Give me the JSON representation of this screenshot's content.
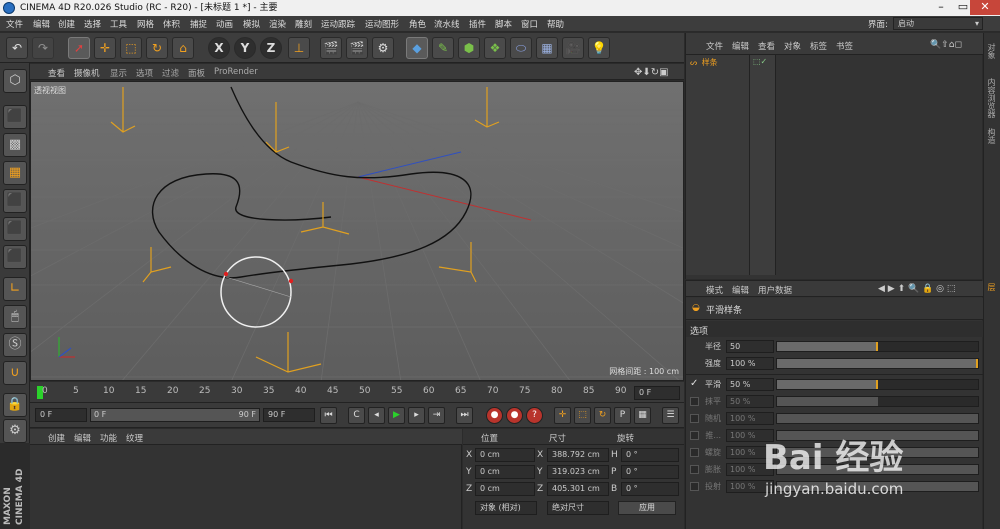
{
  "window": {
    "title": "CINEMA 4D R20.026 Studio (RC - R20) - [未标题 1 *] - 主要"
  },
  "menubar": {
    "items": [
      "文件",
      "编辑",
      "创建",
      "选择",
      "工具",
      "网格",
      "体积",
      "捕捉",
      "动画",
      "模拟",
      "渲染",
      "雕刻",
      "运动跟踪",
      "运动图形",
      "角色",
      "流水线",
      "插件",
      "脚本",
      "窗口",
      "帮助"
    ],
    "layout_label": "界面:",
    "layout_value": "启动"
  },
  "viewport": {
    "menu": [
      "查看",
      "摄像机",
      "显示",
      "选项",
      "过滤",
      "面板",
      "ProRender"
    ],
    "label": "透视视图",
    "grid_spacing": "网格间距 : 100 cm"
  },
  "timeline": {
    "ticks": [
      "0",
      "5",
      "10",
      "15",
      "20",
      "25",
      "30",
      "35",
      "40",
      "45",
      "50",
      "55",
      "60",
      "65",
      "70",
      "75",
      "80",
      "85",
      "90"
    ],
    "current_frame": "0 F"
  },
  "playbar": {
    "start": "0 F",
    "range_start": "0 F",
    "range_end": "90 F",
    "end": "90 F"
  },
  "materials": {
    "tabs": [
      "创建",
      "编辑",
      "功能",
      "纹理"
    ]
  },
  "coordinates": {
    "headers": [
      "位置",
      "尺寸",
      "旋转"
    ],
    "rows": [
      {
        "axis": "X",
        "pos": "0 cm",
        "size_axis": "X",
        "size": "388.792 cm",
        "rot_axis": "H",
        "rot": "0 °"
      },
      {
        "axis": "Y",
        "pos": "0 cm",
        "size_axis": "Y",
        "size": "319.023 cm",
        "rot_axis": "P",
        "rot": "0 °"
      },
      {
        "axis": "Z",
        "pos": "0 cm",
        "size_axis": "Z",
        "size": "405.301 cm",
        "rot_axis": "B",
        "rot": "0 °"
      }
    ],
    "mode": "对象 (相对)",
    "size_mode": "绝对尺寸",
    "apply": "应用"
  },
  "object_manager": {
    "menu": [
      "文件",
      "编辑",
      "查看",
      "对象",
      "标签",
      "书签"
    ],
    "objects": [
      {
        "name": "样条"
      }
    ]
  },
  "attribute_manager": {
    "menu": [
      "模式",
      "编辑",
      "用户数据"
    ],
    "object_name": "平滑样条",
    "section": "选项",
    "radius": {
      "label": "半径",
      "value": "50",
      "fill": 0.5
    },
    "strength": {
      "label": "强度",
      "value": "100 %",
      "fill": 1.0
    },
    "params": [
      {
        "label": "平滑",
        "value": "50 %",
        "fill": 0.5,
        "enabled": true
      },
      {
        "label": "抹平",
        "value": "50 %",
        "fill": 0.5,
        "enabled": false
      },
      {
        "label": "随机",
        "value": "100 %",
        "fill": 1.0,
        "enabled": false
      },
      {
        "label": "推...",
        "value": "100 %",
        "fill": 1.0,
        "enabled": false
      },
      {
        "label": "螺旋",
        "value": "100 %",
        "fill": 1.0,
        "enabled": false
      },
      {
        "label": "膨胀",
        "value": "100 %",
        "fill": 1.0,
        "enabled": false
      },
      {
        "label": "投射",
        "value": "100 %",
        "fill": 1.0,
        "enabled": false
      }
    ]
  },
  "right_strip": [
    "对象",
    "内容浏览器",
    "构造",
    "层"
  ],
  "brand": {
    "logo": "MAXON CINEMA 4D"
  },
  "watermark": {
    "brand": "Bai 经验",
    "url": "jingyan.baidu.com"
  }
}
